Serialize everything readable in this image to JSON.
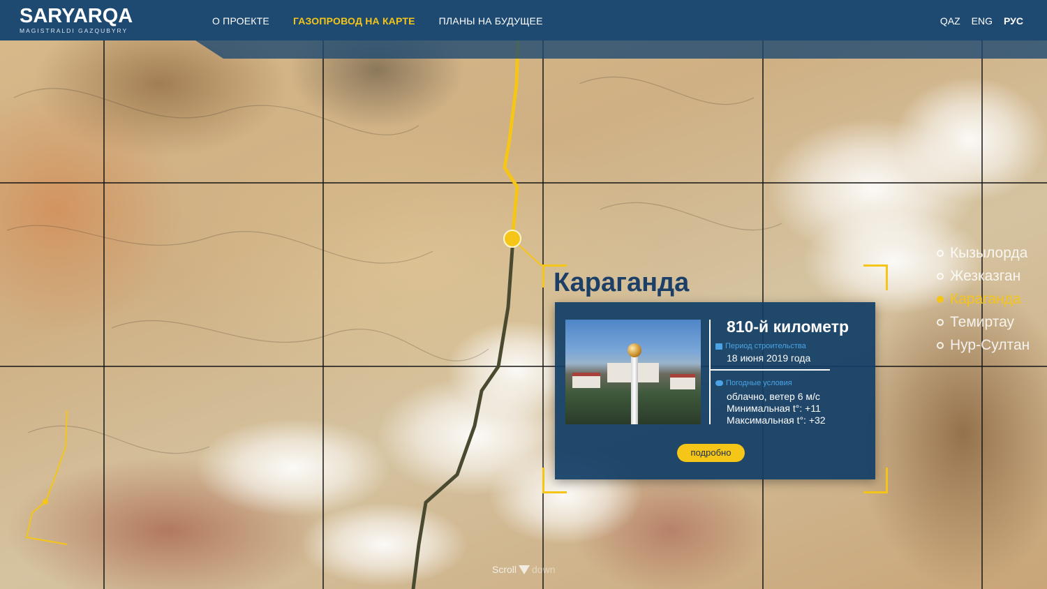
{
  "brand": {
    "title": "SARYARQA",
    "subtitle": "MAGISTRALDI GAZQUBYRY"
  },
  "nav": {
    "items": [
      {
        "label": "О ПРОЕКТЕ",
        "active": false
      },
      {
        "label": "ГАЗОПРОВОД НА КАРТЕ",
        "active": true
      },
      {
        "label": "ПЛАНЫ НА БУДУЩЕЕ",
        "active": false
      }
    ]
  },
  "languages": {
    "items": [
      {
        "label": "QAZ",
        "active": false
      },
      {
        "label": "ENG",
        "active": false
      },
      {
        "label": "РУС",
        "active": true
      }
    ]
  },
  "map": {
    "city_title": "Караганда",
    "pipeline_color": "#f5c518",
    "card": {
      "km_title": "810-й километр",
      "construction_label": "Период строительства",
      "construction_date": "18 июня 2019 года",
      "weather_label": "Погодные условия",
      "weather_desc": "облачно, ветер 6 м/с",
      "min_temp": "Минимальная t°: +11",
      "max_temp": "Максимальная t°: +32",
      "more_button": "подробно"
    }
  },
  "city_list": {
    "items": [
      {
        "label": "Кызылорда",
        "active": false
      },
      {
        "label": "Жезказган",
        "active": false
      },
      {
        "label": "Караганда",
        "active": true
      },
      {
        "label": "Темиртау",
        "active": false
      },
      {
        "label": "Нур-Султан",
        "active": false
      }
    ]
  },
  "scroll_hint": {
    "scroll": "Scroll",
    "down": "down"
  },
  "colors": {
    "header": "#1e4a72",
    "accent": "#f5c518",
    "card": "#123e66",
    "city_title": "#1b3f66"
  }
}
